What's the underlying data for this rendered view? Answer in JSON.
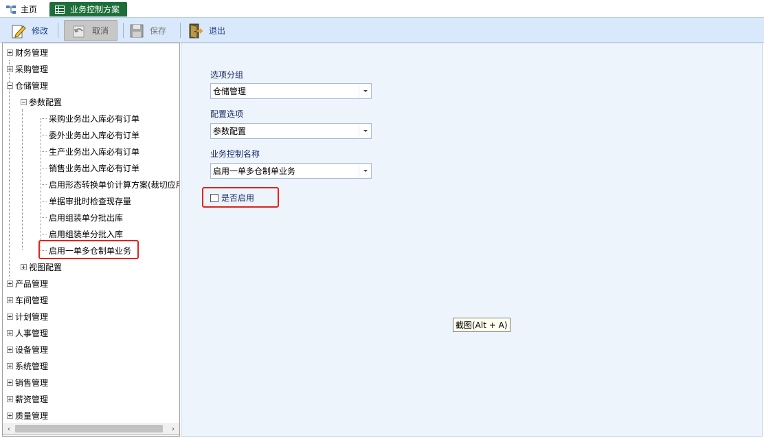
{
  "tabs": {
    "home_label": "主页",
    "active_label": "业务控制方案"
  },
  "toolbar": {
    "edit_label": "修改",
    "cancel_label": "取消",
    "save_label": "保存",
    "exit_label": "退出"
  },
  "tree": {
    "items": [
      {
        "label": "财务管理",
        "state": "collapsed"
      },
      {
        "label": "采购管理",
        "state": "collapsed"
      },
      {
        "label": "仓储管理",
        "state": "expanded"
      },
      {
        "label": "参数配置",
        "state": "expanded"
      },
      {
        "label": "采购业务出入库必有订单"
      },
      {
        "label": "委外业务出入库必有订单"
      },
      {
        "label": "生产业务出入库必有订单"
      },
      {
        "label": "销售业务出入库必有订单"
      },
      {
        "label": "启用形态转换单价计算方案(裁切应用"
      },
      {
        "label": "单据审批时检查现存量"
      },
      {
        "label": "启用组装单分批出库"
      },
      {
        "label": "启用组装单分批入库"
      },
      {
        "label": "启用一单多仓制单业务",
        "selected": true
      },
      {
        "label": "视图配置",
        "state": "collapsed"
      },
      {
        "label": "产品管理",
        "state": "collapsed"
      },
      {
        "label": "车间管理",
        "state": "collapsed"
      },
      {
        "label": "计划管理",
        "state": "collapsed"
      },
      {
        "label": "人事管理",
        "state": "collapsed"
      },
      {
        "label": "设备管理",
        "state": "collapsed"
      },
      {
        "label": "系统管理",
        "state": "collapsed"
      },
      {
        "label": "销售管理",
        "state": "collapsed"
      },
      {
        "label": "薪资管理",
        "state": "collapsed"
      },
      {
        "label": "质量管理",
        "state": "collapsed"
      }
    ]
  },
  "form": {
    "group_label": "选项分组",
    "group_value": "仓储管理",
    "config_label": "配置选项",
    "config_value": "参数配置",
    "name_label": "业务控制名称",
    "name_value": "启用一单多仓制单业务",
    "enable_label": "是否启用",
    "enable_checked": false
  },
  "tooltip": {
    "text": "截图(Alt + A)"
  },
  "colors": {
    "active_tab": "#1e6e3a",
    "toolbar_bg": "#d9e8fa",
    "panel_bg": "#edf4fc",
    "highlight_border": "#e0241b"
  }
}
